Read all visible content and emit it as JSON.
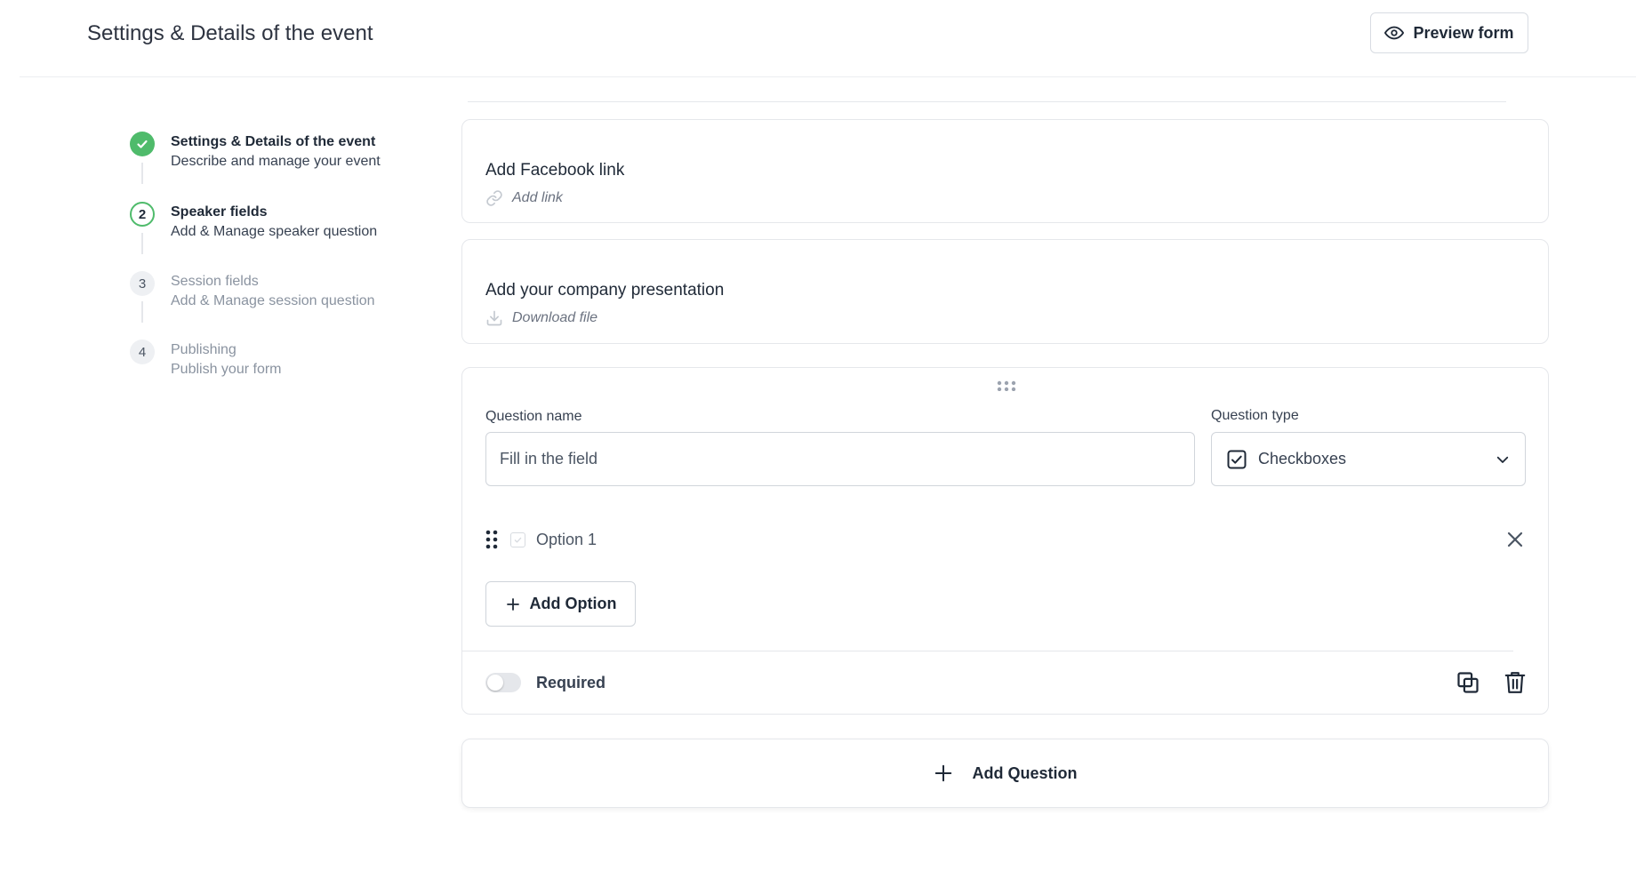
{
  "header": {
    "title": "Settings & Details of the event",
    "preview_label": "Preview form"
  },
  "steps": [
    {
      "title": "Settings & Details of the event",
      "subtitle": "Describe and manage your event",
      "state": "done"
    },
    {
      "number": "2",
      "title": "Speaker fields",
      "subtitle": "Add & Manage speaker question",
      "state": "active"
    },
    {
      "number": "3",
      "title": "Session fields",
      "subtitle": "Add & Manage session question",
      "state": "upcoming"
    },
    {
      "number": "4",
      "title": "Publishing",
      "subtitle": "Publish your form",
      "state": "upcoming"
    }
  ],
  "facebook_card": {
    "title": "Add Facebook link",
    "link_label": "Add link",
    "icon": "link-icon"
  },
  "presentation_card": {
    "title": "Add your company presentation",
    "link_label": "Download file",
    "icon": "download-icon"
  },
  "question_editor": {
    "name_label": "Question name",
    "name_placeholder": "Fill in the field",
    "name_value": "",
    "type_label": "Question type",
    "type_value": "Checkboxes",
    "options": [
      {
        "label": "Option 1"
      }
    ],
    "add_option_label": "Add Option",
    "required_label": "Required",
    "required": false
  },
  "add_question_label": "Add Question",
  "colors": {
    "accent_green": "#4fbb6b",
    "border": "#e5e7eb",
    "text": "#1f2937",
    "muted": "#8a93a0"
  }
}
